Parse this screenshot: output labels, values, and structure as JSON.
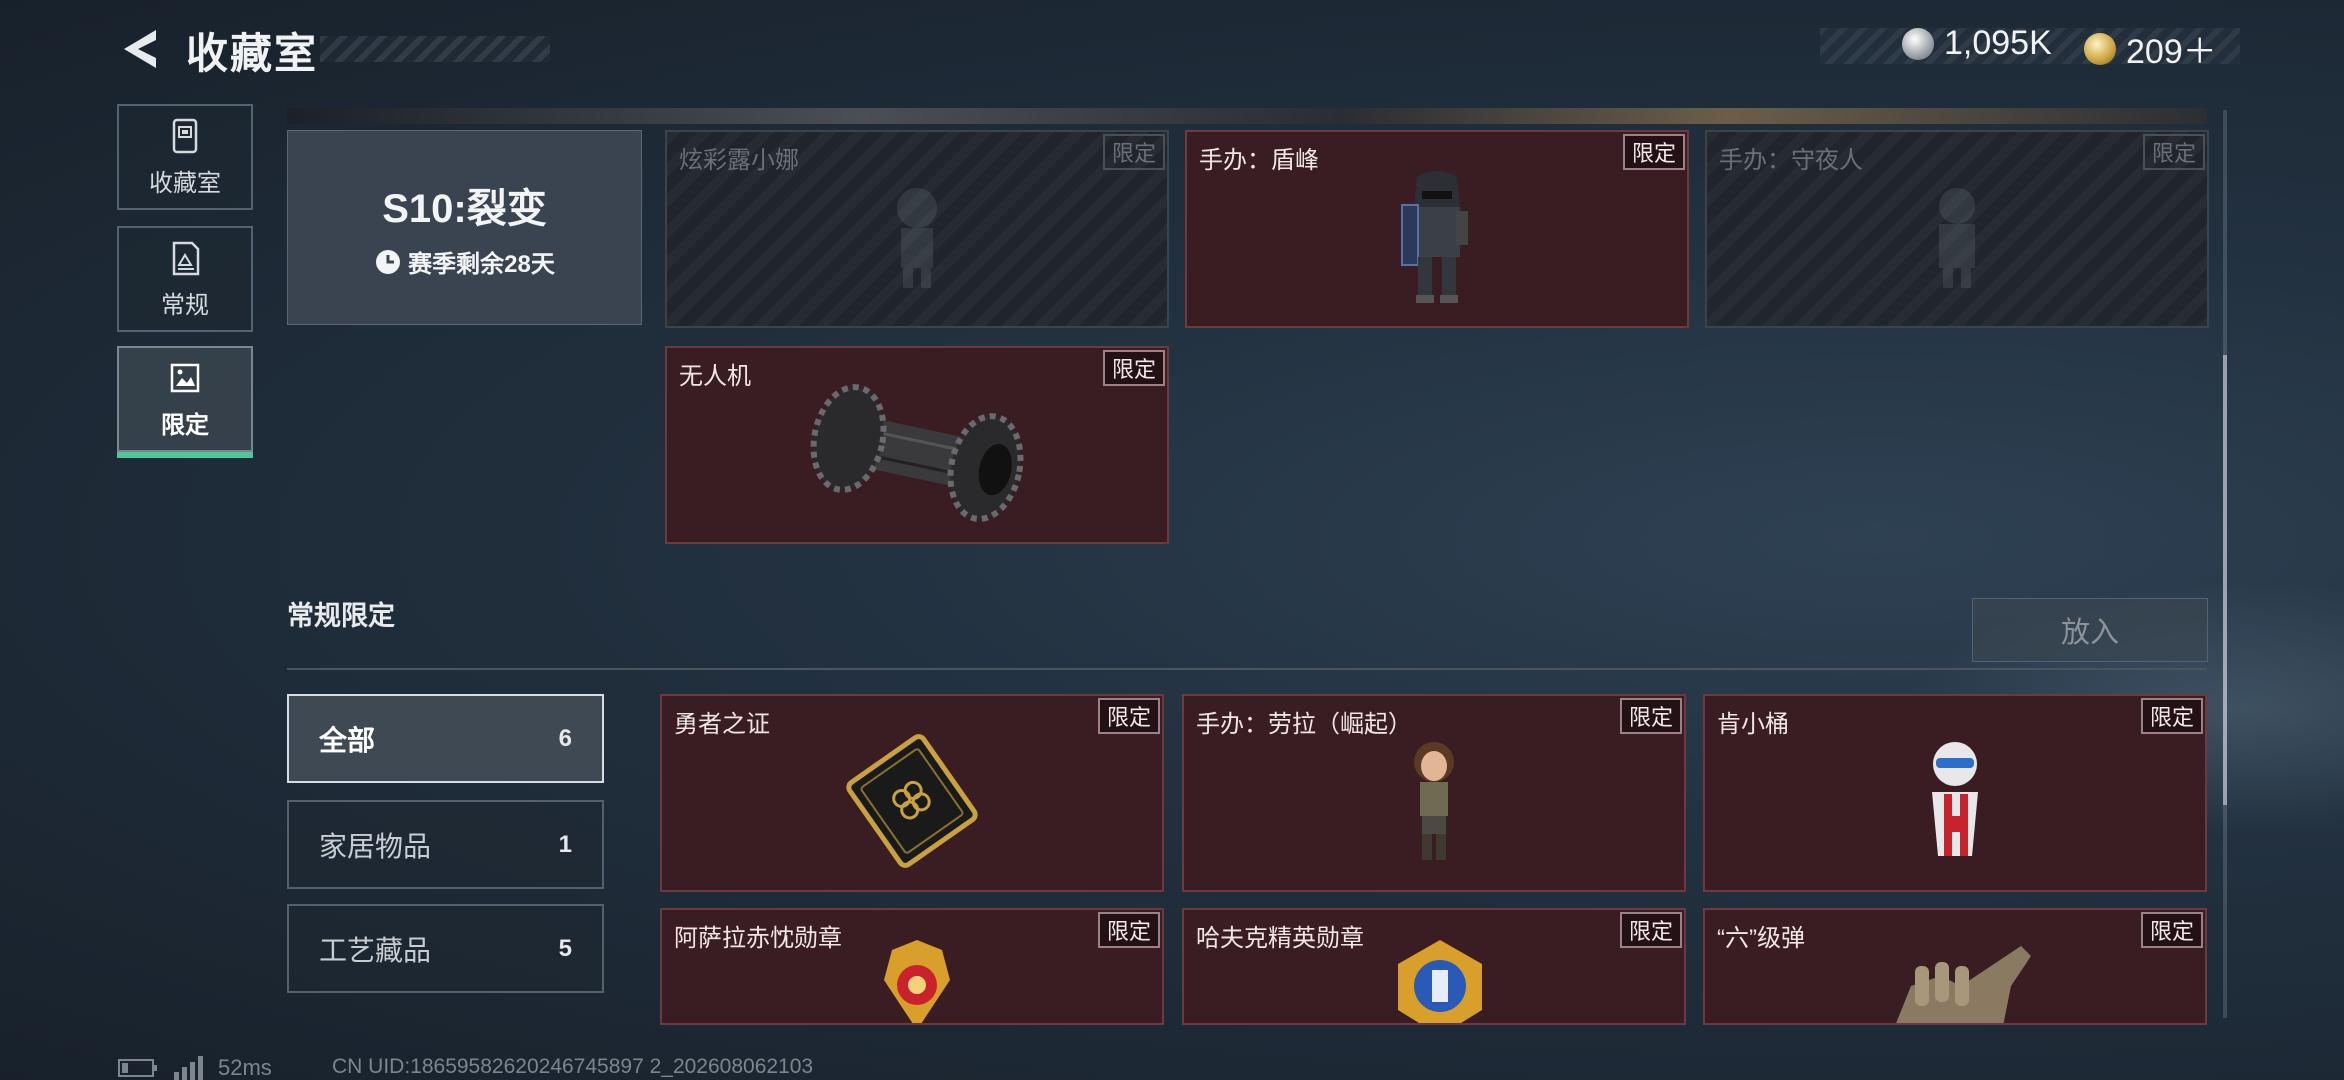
{
  "header": {
    "title": "收藏室",
    "silver_amount": "1,095K",
    "gold_amount": "209＋"
  },
  "nav": [
    {
      "label": "收藏室",
      "icon": "vault-icon"
    },
    {
      "label": "常规",
      "icon": "document-icon"
    },
    {
      "label": "限定",
      "icon": "picture-icon",
      "active": true
    }
  ],
  "season": {
    "title": "S10:裂变",
    "remaining": "赛季剩余28天"
  },
  "season_items": [
    {
      "name": "炫彩露小娜",
      "tag": "限定",
      "locked": true
    },
    {
      "name": "手办：盾峰",
      "tag": "限定",
      "locked": false
    },
    {
      "name": "手办：守夜人",
      "tag": "限定",
      "locked": true
    },
    {
      "name": "无人机",
      "tag": "限定",
      "locked": false
    }
  ],
  "section": {
    "title": "常规限定",
    "put_button": "放入"
  },
  "filters": [
    {
      "label": "全部",
      "count": "6",
      "active": true
    },
    {
      "label": "家居物品",
      "count": "1"
    },
    {
      "label": "工艺藏品",
      "count": "5"
    }
  ],
  "regular_items": [
    {
      "name": "勇者之证",
      "tag": "限定"
    },
    {
      "name": "手办：劳拉（崛起）",
      "tag": "限定"
    },
    {
      "name": "肯小桶",
      "tag": "限定"
    },
    {
      "name": "阿萨拉赤忱勋章",
      "tag": "限定"
    },
    {
      "name": "哈夫克精英勋章",
      "tag": "限定"
    },
    {
      "name": "“六”级弹",
      "tag": "限定"
    }
  ],
  "status": {
    "ping": "52ms",
    "uid": "CN UID:18659582620246745897 2_202608062103"
  },
  "colors": {
    "accent_green": "#4fc79a",
    "card_red": "#3a1d23",
    "background": "#1d2733"
  }
}
